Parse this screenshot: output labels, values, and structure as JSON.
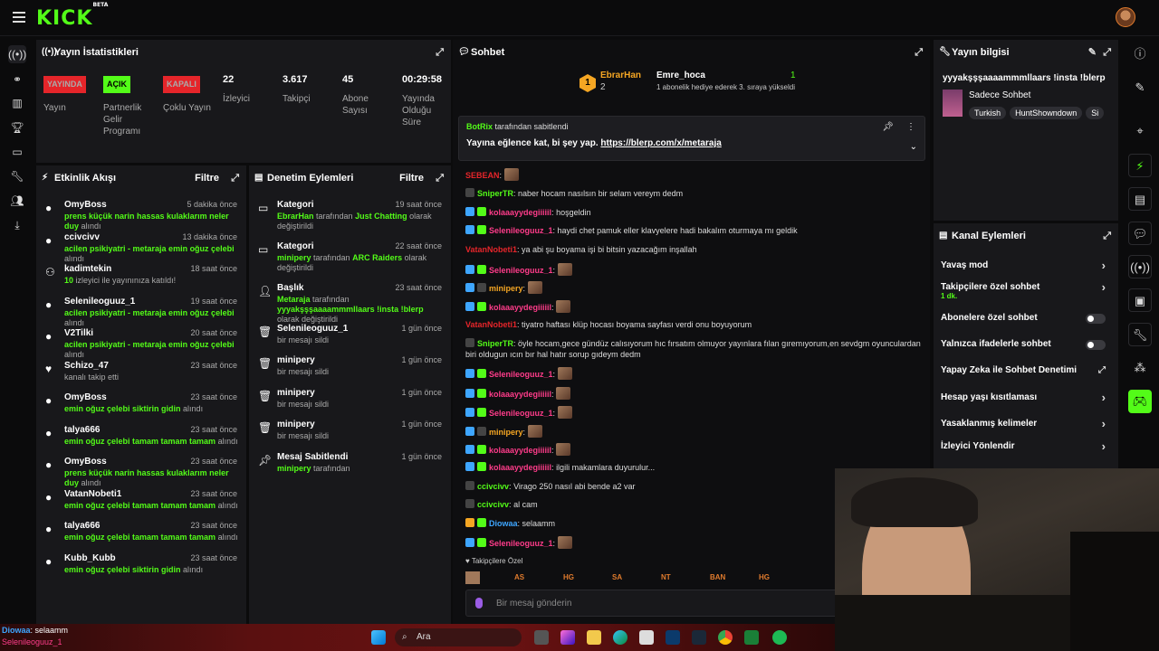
{
  "header": {
    "logo": "KICK",
    "logo_sup": "BETA"
  },
  "stats_panel": {
    "title": "Yayın İstatistikleri",
    "items": [
      {
        "badge": "YAYINDA",
        "badge_color": "#e5252a",
        "label": "Yayın"
      },
      {
        "badge": "AÇIK",
        "badge_color": "#53fc18",
        "label": "Partnerlik Gelir Programı"
      },
      {
        "badge": "KAPALI",
        "badge_color": "#e5252a",
        "label": "Çoklu Yayın"
      },
      {
        "value": "22",
        "label": "İzleyici"
      },
      {
        "value": "3.617",
        "label": "Takipçi"
      },
      {
        "value": "45",
        "label": "Abone Sayısı"
      },
      {
        "value": "00:29:58",
        "label": "Yayında Olduğu Süre"
      }
    ]
  },
  "activity": {
    "title": "Etkinlik Akışı",
    "filter": "Filtre",
    "items": [
      {
        "name": "OmyBoss",
        "time": "5 dakika önce",
        "desc_hl": "prens küçük narin hassas kulaklarım neler duy",
        "desc": "alındı"
      },
      {
        "name": "ccivcivv",
        "time": "13 dakika önce",
        "desc_hl": "acilen psikiyatri - metaraja emin oğuz çelebi",
        "desc": "alındı"
      },
      {
        "name": "kadimtekin",
        "time": "18 saat önce",
        "desc_hl": "10",
        "desc": "izleyici ile yayınınıza katıldı!"
      },
      {
        "name": "Selenileoguuz_1",
        "time": "19 saat önce",
        "desc_hl": "acilen psikiyatri - metaraja emin oğuz çelebi",
        "desc": "alındı"
      },
      {
        "name": "V2Tilki",
        "time": "20 saat önce",
        "desc_hl": "acilen psikiyatri - metaraja emin oğuz çelebi",
        "desc": "alındı"
      },
      {
        "name": "Schizo_47",
        "time": "23 saat önce",
        "desc_hl": "",
        "desc": "kanalı takip etti"
      },
      {
        "name": "OmyBoss",
        "time": "23 saat önce",
        "desc_hl": "emin oğuz çelebi siktirin gidin",
        "desc": "alındı"
      },
      {
        "name": "talya666",
        "time": "23 saat önce",
        "desc_hl": "emin oğuz çelebi tamam tamam tamam",
        "desc": "alındı"
      },
      {
        "name": "OmyBoss",
        "time": "23 saat önce",
        "desc_hl": "prens küçük narin hassas kulaklarım neler duy",
        "desc": "alındı"
      },
      {
        "name": "VatanNobeti1",
        "time": "23 saat önce",
        "desc_hl": "emin oğuz çelebi tamam tamam tamam",
        "desc": "alındı"
      },
      {
        "name": "talya666",
        "time": "23 saat önce",
        "desc_hl": "emin oğuz çelebi tamam tamam tamam",
        "desc": "alındı"
      },
      {
        "name": "Kubb_Kubb",
        "time": "23 saat önce",
        "desc_hl": "emin oğuz çelebi siktirin gidin",
        "desc": "alındı"
      }
    ]
  },
  "moderation": {
    "title": "Denetim Eylemleri",
    "filter": "Filtre",
    "items": [
      {
        "name": "Kategori",
        "time": "19 saat önce",
        "a": "EbrarHan",
        "b": "tarafından",
        "c": "Just Chatting",
        "d": "olarak değiştirildi"
      },
      {
        "name": "Kategori",
        "time": "22 saat önce",
        "a": "minipery",
        "b": "tarafından",
        "c": "ARC Raiders",
        "d": "olarak değiştirildi"
      },
      {
        "name": "Başlık",
        "time": "23 saat önce",
        "a": "Metaraja",
        "b": "tarafından",
        "c": "yyyakşşşaaaammmllaars !insta !blerp",
        "d": "olarak değiştirildi"
      },
      {
        "name": "Selenileoguuz_1",
        "time": "1 gün önce",
        "a": "",
        "b": "bir mesajı sildi",
        "c": "",
        "d": ""
      },
      {
        "name": "minipery",
        "time": "1 gün önce",
        "a": "",
        "b": "bir mesajı sildi",
        "c": "",
        "d": ""
      },
      {
        "name": "minipery",
        "time": "1 gün önce",
        "a": "",
        "b": "bir mesajı sildi",
        "c": "",
        "d": ""
      },
      {
        "name": "minipery",
        "time": "1 gün önce",
        "a": "",
        "b": "bir mesajı sildi",
        "c": "",
        "d": ""
      },
      {
        "name": "Mesaj Sabitlendi",
        "time": "1 gün önce",
        "a": "minipery",
        "b": "tarafından",
        "c": "",
        "d": ""
      }
    ]
  },
  "chat": {
    "title": "Sohbet",
    "gift": {
      "left_name": "EbrarHan",
      "left_num": "2",
      "rank": "1",
      "right_name": "Emre_hoca",
      "right_num": "1",
      "desc": "1 abonelik hediye ederek 3. sıraya yükseldi"
    },
    "pinned": {
      "by": "BotRix",
      "by_suffix": "tarafından sabitlendi",
      "text": "Yayına eğlence kat, bi şey yap.",
      "link": "https://blerp.com/x/metaraja"
    },
    "messages": [
      {
        "user": "SEBEAN",
        "color": "#e5252a",
        "text": ""
      },
      {
        "user": "SniperTR",
        "color": "#53fc18",
        "text": "naber hocam nasılsın bir selam vereym dedm"
      },
      {
        "user": "kolaaayydegiiiiil",
        "color": "#ff3c8a",
        "text": "hoşgeldin"
      },
      {
        "user": "Selenileoguuz_1",
        "color": "#ff3c8a",
        "text": "haydi chet pamuk eller klavyelere hadi bakalım oturmaya mı geldik"
      },
      {
        "user": "VatanNobeti1",
        "color": "#e5252a",
        "text": "ya abi şu boyama işi bi bitsin yazacağım inşallah"
      },
      {
        "user": "Selenileoguuz_1",
        "color": "#ff3c8a",
        "text": ""
      },
      {
        "user": "minipery",
        "color": "#f5a623",
        "text": ""
      },
      {
        "user": "kolaaayydegiiiiil",
        "color": "#ff3c8a",
        "text": ""
      },
      {
        "user": "VatanNobeti1",
        "color": "#e5252a",
        "text": "tiyatro haftası klüp hocası boyama sayfası verdi onu boyuyorum"
      },
      {
        "user": "SniperTR",
        "color": "#53fc18",
        "text": "öyle hocam,gece gündüz calısıyorum hıc fırsatım olmuyor yayınlara fılan gıremıyorum,en sevdgm oyunculardan biri oldugun ıcın bır hal hatır sorup gıdeym dedm"
      },
      {
        "user": "Selenileoguuz_1",
        "color": "#ff3c8a",
        "text": ""
      },
      {
        "user": "kolaaayydegiiiiil",
        "color": "#ff3c8a",
        "text": ""
      },
      {
        "user": "Selenileoguuz_1",
        "color": "#ff3c8a",
        "text": ""
      },
      {
        "user": "minipery",
        "color": "#f5a623",
        "text": ""
      },
      {
        "user": "kolaaayydegiiiiil",
        "color": "#ff3c8a",
        "text": ""
      },
      {
        "user": "kolaaayydegiiiiil",
        "color": "#ff3c8a",
        "text": "ilgili makamlara duyurulur..."
      },
      {
        "user": "ccivcivv",
        "color": "#53fc18",
        "text": "Virago 250 nasıl abi bende a2 var"
      },
      {
        "user": "ccivcivv",
        "color": "#53fc18",
        "text": "al cam"
      },
      {
        "user": "Diowaa",
        "color": "#3ea6ff",
        "text": "selaamm"
      },
      {
        "user": "Selenileoguuz_1",
        "color": "#ff3c8a",
        "text": ""
      }
    ],
    "followers_only": "Takipçilere Özel",
    "emotes": [
      "AS",
      "HG",
      "SA",
      "NT",
      "BAN",
      "HG"
    ],
    "placeholder": "Bir mesaj gönderin"
  },
  "stream_info": {
    "title": "Yayın bilgisi",
    "stream_title": "yyyakşşşaaaammmllaars !insta !blerp",
    "category": "Sadece Sohbet",
    "tags": [
      "Turkish",
      "HuntShowndown",
      "Si"
    ]
  },
  "channel_actions": {
    "title": "Kanal Eylemleri",
    "items": [
      {
        "label": "Yavaş mod",
        "sub": "",
        "type": "chevron"
      },
      {
        "label": "Takipçilere özel sohbet",
        "sub": "1 dk.",
        "type": "chevron"
      },
      {
        "label": "Abonelere özel sohbet",
        "sub": "",
        "type": "toggle"
      },
      {
        "label": "Yalnızca ifadelerle sohbet",
        "sub": "",
        "type": "toggle"
      },
      {
        "label": "Yapay Zeka ile Sohbet Denetimi",
        "sub": "",
        "type": "external"
      },
      {
        "label": "Hesap yaşı kısıtlaması",
        "sub": "",
        "type": "chevron"
      },
      {
        "label": "Yasaklanmış kelimeler",
        "sub": "",
        "type": "chevron"
      },
      {
        "label": "İzleyici Yönlendir",
        "sub": "",
        "type": "chevron"
      }
    ]
  },
  "overlay": {
    "chat_user": "Diowaa",
    "chat_text": "selaamm",
    "chat_user2": "Selenileoguuz_1"
  },
  "taskbar": {
    "search": "Ara"
  }
}
